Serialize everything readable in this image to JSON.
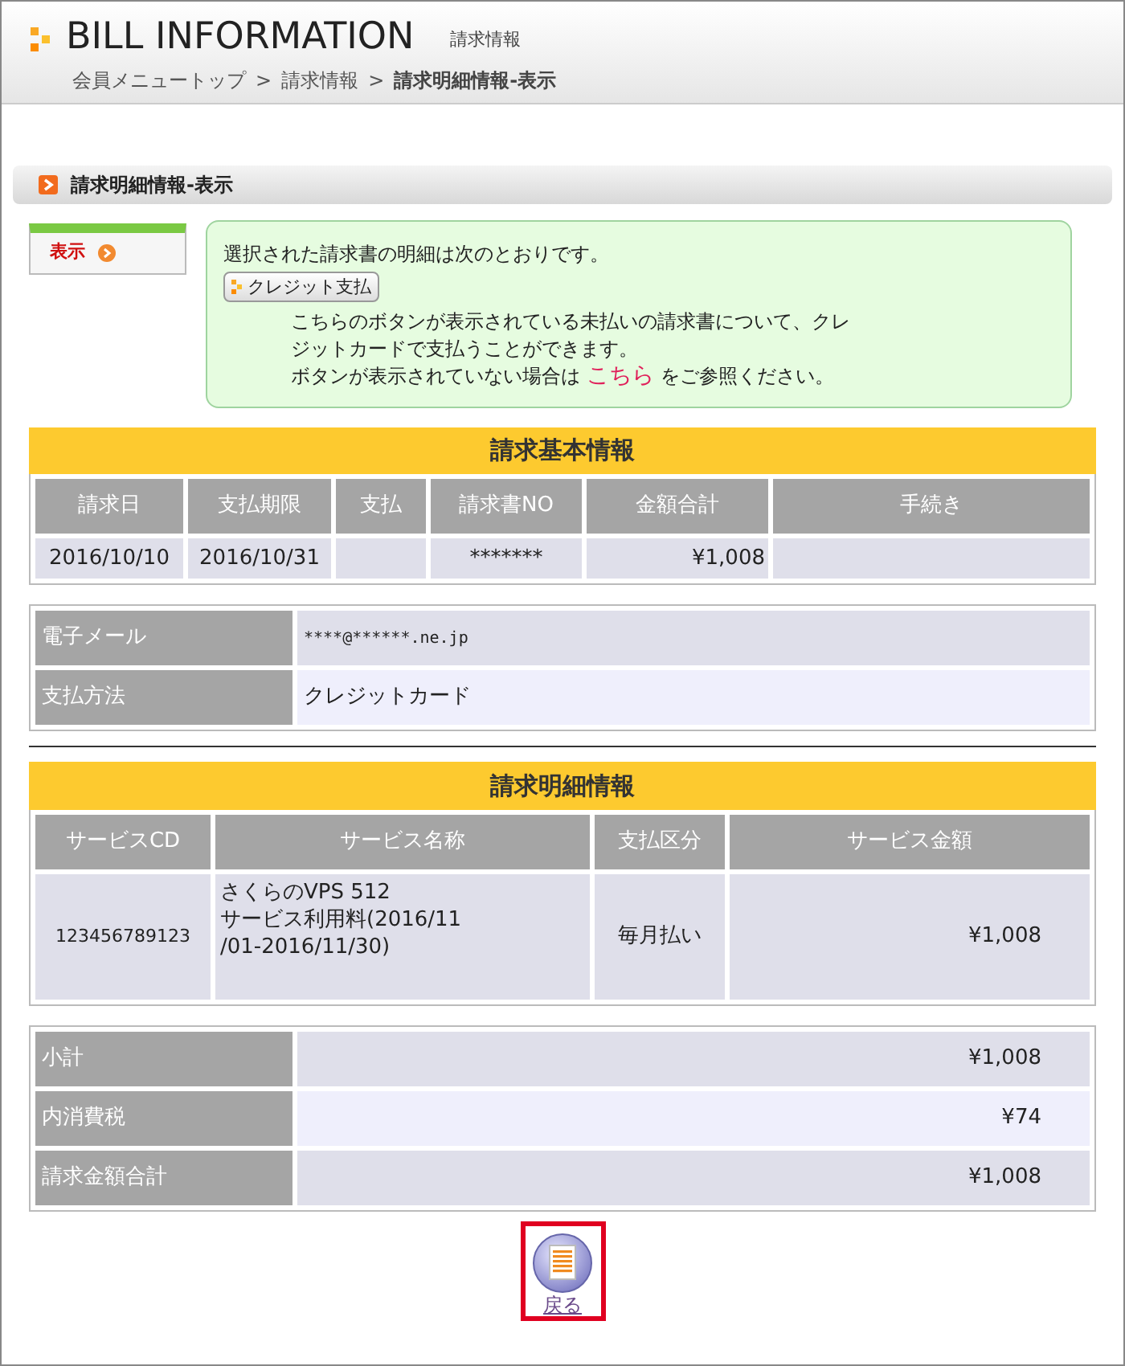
{
  "header": {
    "title": "BILL INFORMATION",
    "subtitle": "請求情報",
    "breadcrumb": [
      {
        "label": "会員メニュートップ",
        "current": false
      },
      {
        "label": "請求情報",
        "current": false
      },
      {
        "label": "請求明細情報-表示",
        "current": true
      }
    ],
    "separator": ">"
  },
  "section_title": "請求明細情報-表示",
  "view_tab": {
    "label": "表示"
  },
  "notice": {
    "intro": "選択された請求書の明細は次のとおりです。",
    "button": "クレジット支払",
    "lines": [
      "こちらのボタンが表示されている未払いの請求書について、クレ",
      "ジットカードで支払うことができます。"
    ],
    "before_link": "ボタンが表示されていない場合は",
    "link": "こちら",
    "after_link": "をご参照ください。"
  },
  "basic_info": {
    "title": "請求基本情報",
    "columns": [
      "請求日",
      "支払期限",
      "支払",
      "請求書NO",
      "金額合計",
      "手続き"
    ],
    "row": {
      "billing_date": "2016/10/10",
      "due_date": "2016/10/31",
      "invoice_no": "*******",
      "total": "¥1,008"
    }
  },
  "contact": [
    {
      "label": "電子メール",
      "value": "****@******.ne.jp",
      "kind": "mono"
    },
    {
      "label": "支払方法",
      "value": "クレジットカード",
      "kind": "text"
    }
  ],
  "detail_info": {
    "title": "請求明細情報",
    "columns": [
      "サービスCD",
      "サービス名称",
      "支払区分",
      "サービス金額"
    ],
    "rows": [
      {
        "code": "123456789123",
        "name": [
          "さくらのVPS 512",
          "サービス利用料(2016/11",
          "/01-2016/11/30)"
        ],
        "payment": "毎月払い",
        "amount": "¥1,008"
      }
    ]
  },
  "totals": [
    {
      "label": "小計",
      "value": "¥1,008"
    },
    {
      "label": "内消費税",
      "value": "¥74"
    },
    {
      "label": "請求金額合計",
      "value": "¥1,008"
    }
  ],
  "back_button": {
    "label": "戻る",
    "highlighted": true
  }
}
